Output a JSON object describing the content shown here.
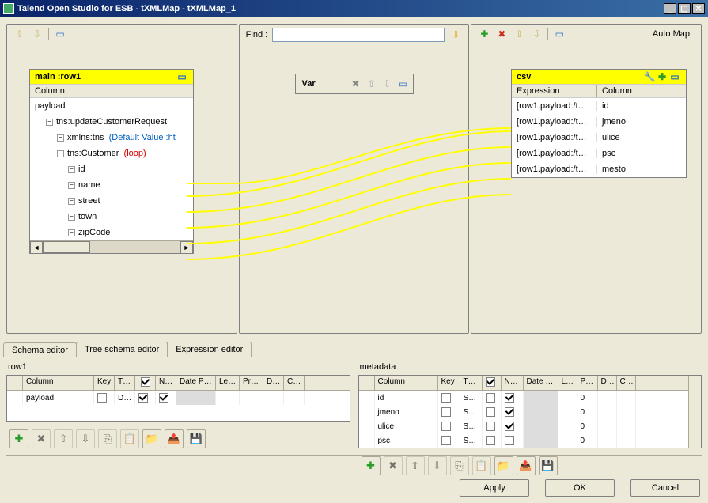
{
  "title": "Talend Open Studio for ESB - tXMLMap - tXMLMap_1",
  "findLabel": "Find :",
  "varLabel": "Var",
  "autoMapLabel": "Auto Map",
  "main": {
    "title": "main :row1",
    "columnHeader": "Column",
    "tree": {
      "root": "payload",
      "req": "tns:updateCustomerRequest",
      "xmlns": "xmlns:tns",
      "xmlnsDefault": "(Default Value :ht",
      "customer": "tns:Customer",
      "customerLoop": "(loop)",
      "fields": [
        "id",
        "name",
        "street",
        "town",
        "zipCode"
      ]
    }
  },
  "csv": {
    "title": "csv",
    "exprHeader": "Expression",
    "colHeader": "Column",
    "rows": [
      {
        "expr": "[row1.payload:/t…",
        "col": "id"
      },
      {
        "expr": "[row1.payload:/t…",
        "col": "jmeno"
      },
      {
        "expr": "[row1.payload:/t…",
        "col": "ulice"
      },
      {
        "expr": "[row1.payload:/t…",
        "col": "psc"
      },
      {
        "expr": "[row1.payload:/t…",
        "col": "mesto"
      }
    ]
  },
  "tabs": {
    "schema": "Schema editor",
    "tree": "Tree schema editor",
    "expr": "Expression editor"
  },
  "left": {
    "title": "row1",
    "headers": {
      "col": "Column",
      "key": "Key",
      "type": "T…",
      "chk": "✓",
      "null": "N…",
      "dp": "Date P…",
      "len": "Le…",
      "prec": "Pr…",
      "def": "D…",
      "com": "C…"
    },
    "rows": [
      {
        "col": "payload",
        "key": false,
        "type": "D…",
        "chk": true,
        "null": true,
        "dp": "",
        "len": "",
        "prec": "",
        "def": "",
        "com": ""
      }
    ]
  },
  "right": {
    "title": "metadata",
    "headers": {
      "col": "Column",
      "key": "Key",
      "type": "T…",
      "chk": "✓",
      "null": "N…",
      "dp": "Date …",
      "len": "L…",
      "prec": "P…",
      "def": "D…",
      "com": "C…"
    },
    "rows": [
      {
        "col": "id",
        "key": false,
        "type": "S…",
        "chk": false,
        "null": true,
        "dp": "",
        "len": "",
        "prec": "0",
        "def": "",
        "com": ""
      },
      {
        "col": "jmeno",
        "key": false,
        "type": "S…",
        "chk": false,
        "null": true,
        "dp": "",
        "len": "",
        "prec": "0",
        "def": "",
        "com": ""
      },
      {
        "col": "ulice",
        "key": false,
        "type": "S…",
        "chk": false,
        "null": true,
        "dp": "",
        "len": "",
        "prec": "0",
        "def": "",
        "com": ""
      },
      {
        "col": "psc",
        "key": false,
        "type": "S…",
        "chk": false,
        "null": false,
        "dp": "",
        "len": "",
        "prec": "0",
        "def": "",
        "com": ""
      }
    ]
  },
  "buttons": {
    "apply": "Apply",
    "ok": "OK",
    "cancel": "Cancel"
  }
}
